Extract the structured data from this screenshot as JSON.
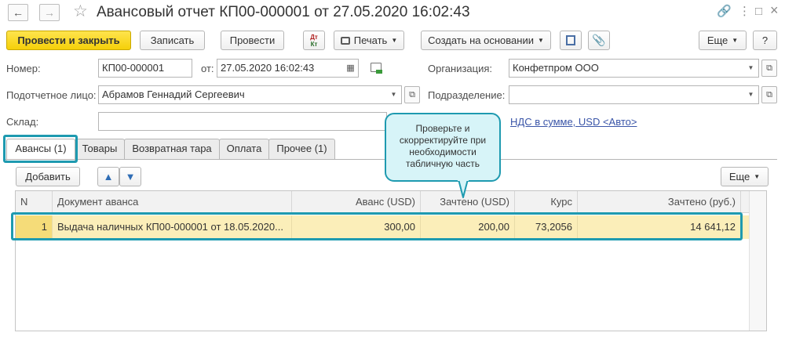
{
  "window": {
    "title": "Авансовый отчет КП00-000001 от 27.05.2020 16:02:43",
    "back_icon": "←",
    "forward_icon": "→",
    "star_icon": "☆",
    "link_icon": "🔗",
    "more_icon": "⋮",
    "maximize_icon": "□",
    "close_icon": "×"
  },
  "toolbar": {
    "post_and_close": "Провести и закрыть",
    "save": "Записать",
    "post": "Провести",
    "dt_kt_top": "Дт",
    "dt_kt_bottom": "Кт",
    "print": "Печать",
    "create_based_on": "Создать на основании",
    "more": "Еще",
    "help": "?"
  },
  "form": {
    "number_label": "Номер:",
    "number_value": "КП00-000001",
    "date_label": "от:",
    "date_value": "27.05.2020 16:02:43",
    "organization_label": "Организация:",
    "organization_value": "Конфетпром ООО",
    "person_label": "Подотчетное лицо:",
    "person_value": "Абрамов Геннадий Сергеевич",
    "department_label": "Подразделение:",
    "department_value": "",
    "warehouse_label": "Склад:",
    "warehouse_value": "",
    "vat_link": "НДС в сумме, USD <Авто>"
  },
  "tabs": [
    {
      "label": "Авансы (1)",
      "active": true
    },
    {
      "label": "Товары",
      "active": false
    },
    {
      "label": "Возвратная тара",
      "active": false
    },
    {
      "label": "Оплата",
      "active": false
    },
    {
      "label": "Прочее (1)",
      "active": false
    }
  ],
  "table_toolbar": {
    "add": "Добавить",
    "up_icon": "🡅",
    "down_icon": "🡇",
    "more": "Еще"
  },
  "table": {
    "columns": [
      "N",
      "Документ аванса",
      "Аванс (USD)",
      "Зачтено (USD)",
      "Курс",
      "Зачтено (руб.)"
    ],
    "rows": [
      [
        "1",
        "Выдача наличных КП00-000001 от 18.05.2020...",
        "300,00",
        "200,00",
        "73,2056",
        "14 641,12"
      ]
    ]
  },
  "callout": {
    "text": "Проверьте и скорректируйте при необходимости табличную часть"
  },
  "colors": {
    "primary_button": "#f5d009",
    "highlight": "#1e9ab0",
    "selected_row": "#fbeeb9",
    "link": "#3a55a8"
  }
}
